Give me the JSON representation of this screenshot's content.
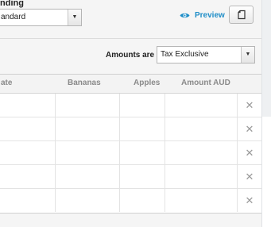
{
  "branding": {
    "label": "nding",
    "selected": "andard"
  },
  "preview": {
    "label": "Preview"
  },
  "amounts": {
    "label": "Amounts are",
    "selected": "Tax Exclusive"
  },
  "table": {
    "columns": [
      "ate",
      "Bananas",
      "Apples",
      "Amount AUD"
    ],
    "rows": [
      {
        "remove": "✕"
      },
      {
        "remove": "✕"
      },
      {
        "remove": "✕"
      },
      {
        "remove": "✕"
      },
      {
        "remove": "✕"
      }
    ]
  },
  "colors": {
    "accent": "#1e8dc7",
    "header_text": "#8a8a8a",
    "panel_bg": "#f5f5f5"
  },
  "icons": {
    "preview": "eye-icon",
    "copy": "copy-icon",
    "dropdown": "chevron-down-icon",
    "remove": "close-icon"
  }
}
